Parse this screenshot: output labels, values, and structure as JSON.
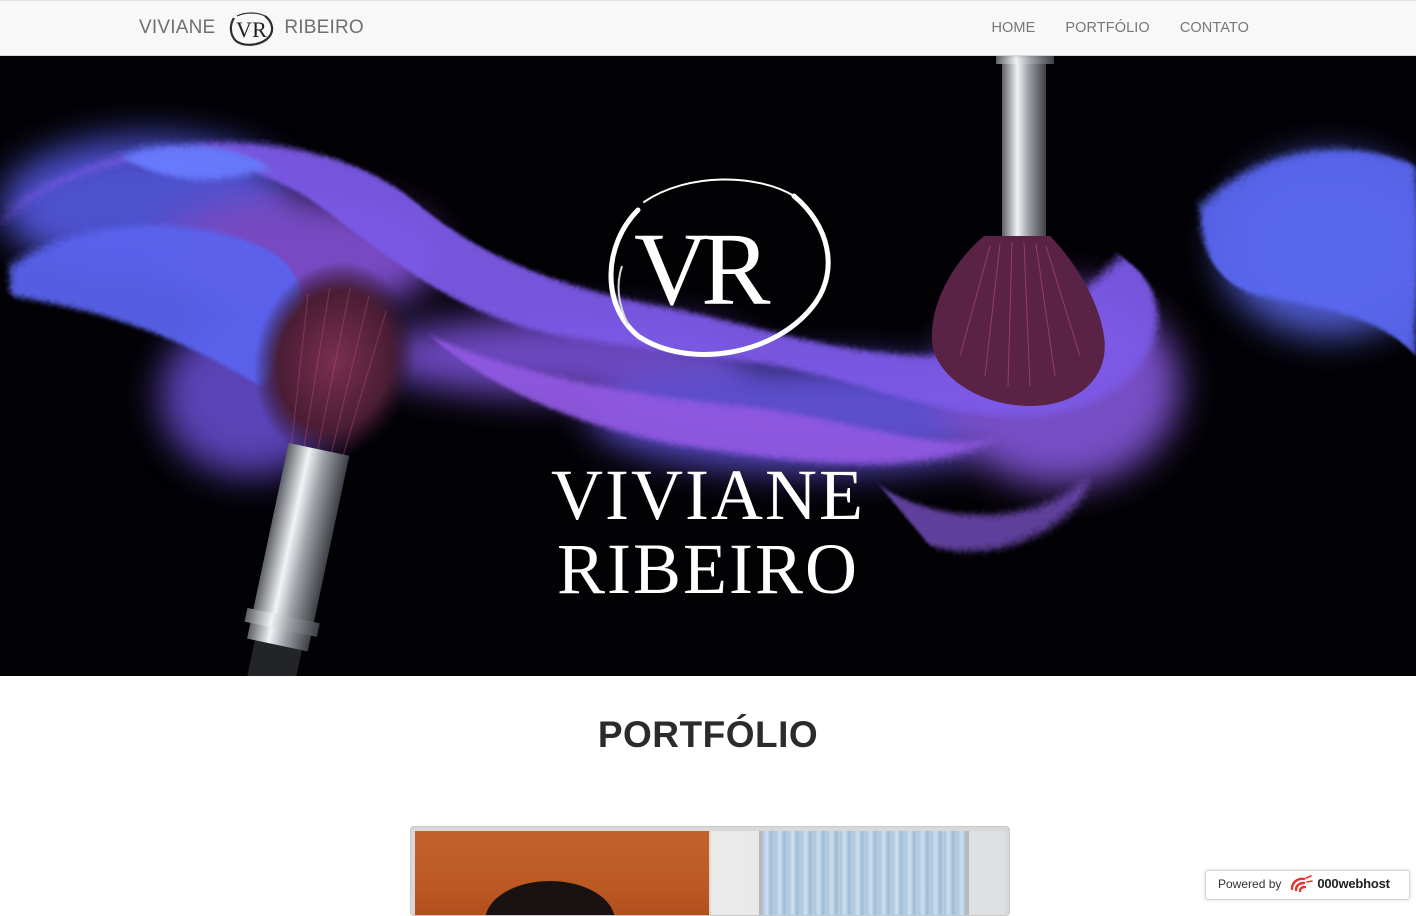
{
  "navbar": {
    "brand_first": "VIVIANE",
    "brand_last": "RIBEIRO",
    "logo_icon": "vr-monogram-icon",
    "links": [
      {
        "label": "HOME"
      },
      {
        "label": "PORTFÓLIO"
      },
      {
        "label": "CONTATO"
      }
    ]
  },
  "hero": {
    "monogram": "VR",
    "name_first": "VIVIANE",
    "name_last": "RIBEIRO",
    "background_color": "#020104",
    "powder_colors": [
      "#6a5cff",
      "#9b59e6",
      "#b46ef0",
      "#5b6cf2"
    ]
  },
  "portfolio": {
    "title": "PORTFÓLIO"
  },
  "badge": {
    "label": "Powered by",
    "host": "000webhost",
    "host_icon": "000webhost-logo-icon",
    "accent": "#e8322f"
  }
}
